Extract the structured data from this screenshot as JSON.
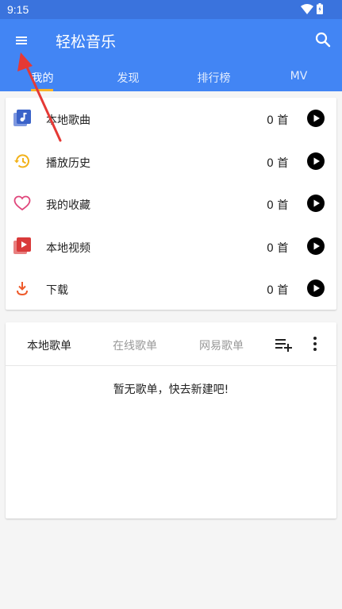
{
  "status": {
    "time": "9:15"
  },
  "app": {
    "title": "轻松音乐"
  },
  "tabs": [
    {
      "label": "我的",
      "active": true
    },
    {
      "label": "发现",
      "active": false
    },
    {
      "label": "排行榜",
      "active": false
    },
    {
      "label": "MV",
      "active": false
    }
  ],
  "library": [
    {
      "label": "本地歌曲",
      "count": "0 首",
      "icon": "local-music-icon",
      "color": "#3b63c9"
    },
    {
      "label": "播放历史",
      "count": "0 首",
      "icon": "history-icon",
      "color": "#f2b21b"
    },
    {
      "label": "我的收藏",
      "count": "0 首",
      "icon": "heart-icon",
      "color": "#e0457b"
    },
    {
      "label": "本地视频",
      "count": "0 首",
      "icon": "video-icon",
      "color": "#d93a3a"
    },
    {
      "label": "下载",
      "count": "0 首",
      "icon": "download-icon",
      "color": "#ee5a2a"
    }
  ],
  "playlists": {
    "tabs": [
      "本地歌单",
      "在线歌单",
      "网易歌单"
    ],
    "empty_text": "暂无歌单，快去新建吧!"
  },
  "colors": {
    "primary": "#4285f4",
    "statusbar": "#3a73dd",
    "tab_indicator": "#f7b42a",
    "annotation_arrow": "#e53935"
  }
}
